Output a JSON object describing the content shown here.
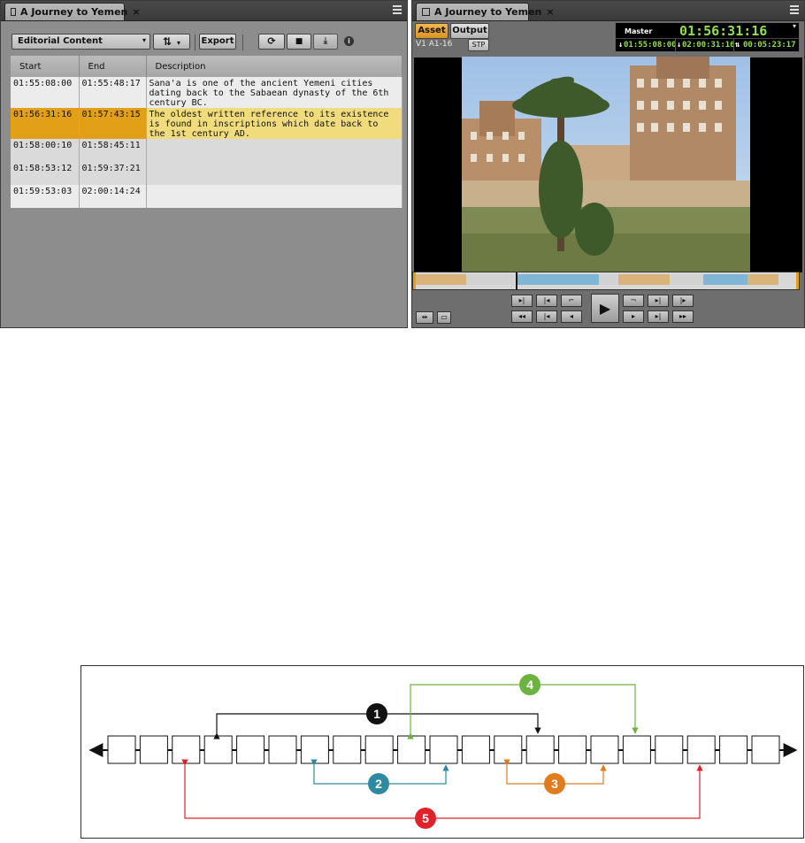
{
  "left_panel": {
    "tab_title": "A Journey to Yemen",
    "tab_close": "×",
    "dropdown_label": "Editorial Content",
    "export_label": "Export",
    "info_glyph": "i",
    "columns": [
      "Start",
      "End",
      "Description"
    ],
    "rows": [
      {
        "start": "01:55:08:00",
        "end": "01:55:48:17",
        "description": "Sana'a is one of the ancient Yemeni cities dating back to the Sabaean dynasty of the 6th century BC.",
        "selected": false
      },
      {
        "start": "01:56:31:16",
        "end": "01:57:43:15",
        "description": "The oldest written reference to its existence is found in inscriptions which date back to the 1st century AD.",
        "selected": true
      },
      {
        "start": "01:58:00:10",
        "end": "01:58:45:11",
        "description": "",
        "selected": false
      },
      {
        "start": "01:58:53:12",
        "end": "01:59:37:21",
        "description": "",
        "selected": false
      },
      {
        "start": "01:59:53:03",
        "end": "02:00:14:24",
        "description": "",
        "selected": false
      }
    ]
  },
  "right_panel": {
    "tab_title": "A Journey to Yemen",
    "tab_close": "×",
    "asset_label": "Asset",
    "output_label": "Output",
    "tracks": "V1 A1-16",
    "stp_label": "STP",
    "master_label": "Master",
    "master_tc": "01:56:31:16",
    "mark_in_tc": "01:55:08:00",
    "mark_out_tc": "02:00:31:16",
    "duration_tc": "00:05:23:17",
    "tc_color": "#8ee04a",
    "play_glyph": "▶"
  },
  "diagram": {
    "cell_count": 21,
    "markers": [
      {
        "label": "1",
        "color": "#111111"
      },
      {
        "label": "2",
        "color": "#2e8aa0"
      },
      {
        "label": "3",
        "color": "#e07b1e"
      },
      {
        "label": "4",
        "color": "#6cb33f"
      },
      {
        "label": "5",
        "color": "#e3212b"
      }
    ]
  }
}
